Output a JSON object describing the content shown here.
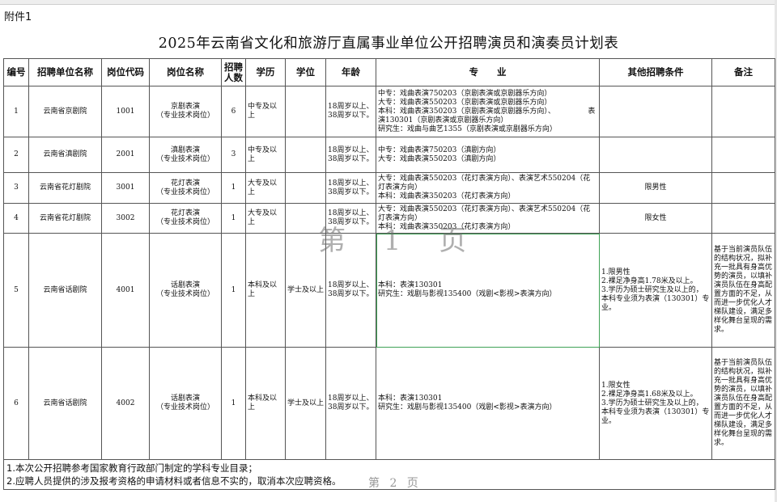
{
  "attachment_label": "附件1",
  "title": "2025年云南省文化和旅游厅直属事业单位公开招聘演员和演奏员计划表",
  "headers": {
    "no": "编号",
    "unit": "招聘单位名称",
    "code": "岗位代码",
    "post": "岗位名称",
    "count": "招聘\n人数",
    "edu": "学历",
    "degree": "学位",
    "age": "年龄",
    "major": "专　　业",
    "other": "其他招聘条件",
    "remark": "备注"
  },
  "rows": [
    {
      "no": "1",
      "unit": "云南省京剧院",
      "code": "1001",
      "post": "京剧表演\n（专业技术岗位）",
      "count": "6",
      "edu": "中专及以上",
      "degree": "",
      "age": "18周岁以上、\n38周岁以下。",
      "major": "中专：戏曲表演750203（京剧表演或京剧器乐方向）\n大专：戏曲表演550203（京剧表演或京剧器乐方向）\n本科：戏曲表演350203（京剧表演或京剧器乐方向）、　　　　　表演130301（京剧表演或京剧器乐方向）\n研究生：戏曲与曲艺1355（京剧表演或京剧器乐方向）",
      "other": "",
      "remark": ""
    },
    {
      "no": "2",
      "unit": "云南省滇剧院",
      "code": "2001",
      "post": "滇剧表演\n（专业技术岗位）",
      "count": "3",
      "edu": "中专及以上",
      "degree": "",
      "age": "18周岁以上、\n38周岁以下。",
      "major": "中专：戏曲表演750203（滇剧方向）\n大专：戏曲表演550203（滇剧方向）",
      "other": "",
      "remark": ""
    },
    {
      "no": "3",
      "unit": "云南省花灯剧院",
      "code": "3001",
      "post": "花灯表演\n（专业技术岗位）",
      "count": "1",
      "edu": "大专及以上",
      "degree": "",
      "age": "18周岁以上、\n38周岁以下。",
      "major": "大专：戏曲表演550203（花灯表演方向）、表演艺术550204（花灯表演方向）\n本科：戏曲表演350203（花灯表演方向）",
      "other": "限男性",
      "remark": ""
    },
    {
      "no": "4",
      "unit": "云南省花灯剧院",
      "code": "3002",
      "post": "花灯表演\n（专业技术岗位）",
      "count": "1",
      "edu": "大专及以上",
      "degree": "",
      "age": "18周岁以上、\n38周岁以下。",
      "major": "大专：戏曲表演550203（花灯表演方向）、表演艺术550204（花灯表演方向）\n本科：戏曲表演350203（花灯表演方向）",
      "other": "限女性",
      "remark": ""
    },
    {
      "no": "5",
      "unit": "云南省话剧院",
      "code": "4001",
      "post": "话剧表演\n（专业技术岗位）",
      "count": "1",
      "edu": "本科及以上",
      "degree": "学士及以上",
      "age": "18周岁以上、\n38周岁以下。",
      "major": "本科：表演130301\n研究生：戏剧与影视135400（戏剧<影视>表演方向）",
      "other": "1.限男性　　　　　　　　　　　2.裸足净身高1.78米及以上。\n3.学历为硕士研究生及以上的，本科专业须为表演（130301）专业。",
      "remark": "基于当前演员队伍的结构状况，拟补充一批具有身高优势的演员，以填补演员队伍在身高配置方面的不足，从而进一步优化人才梯队建设，满足多样化舞台呈现的需求。"
    },
    {
      "no": "6",
      "unit": "云南省话剧院",
      "code": "4002",
      "post": "话剧表演\n（专业技术岗位）",
      "count": "1",
      "edu": "本科及以上",
      "degree": "学士及以上",
      "age": "18周岁以上、\n38周岁以下。",
      "major": "本科：表演130301\n研究生：戏剧与影视135400（戏剧<影视>表演方向）",
      "other": "1.限女性　　　　　　　　　　　2.裸足净身高1.68米及以上。\n3.学历为硕士研究生及以上的，本科专业须为表演（130301）专业。",
      "remark": "基于当前演员队伍的结构状况，拟补充一批具有身高优势的演员，以填补演员队伍在身高配置方面的不足，从而进一步优化人才梯队建设，满足多样化舞台呈现的需求。"
    }
  ],
  "notes": [
    "1.本次公开招聘参考国家教育行政部门制定的学科专业目录；",
    "2.应聘人员提供的涉及报考资格的申请材料或者信息不实的，取消本次应聘资格。"
  ],
  "watermark_page1": "第 1 页",
  "watermark_page2": "第 2 页"
}
